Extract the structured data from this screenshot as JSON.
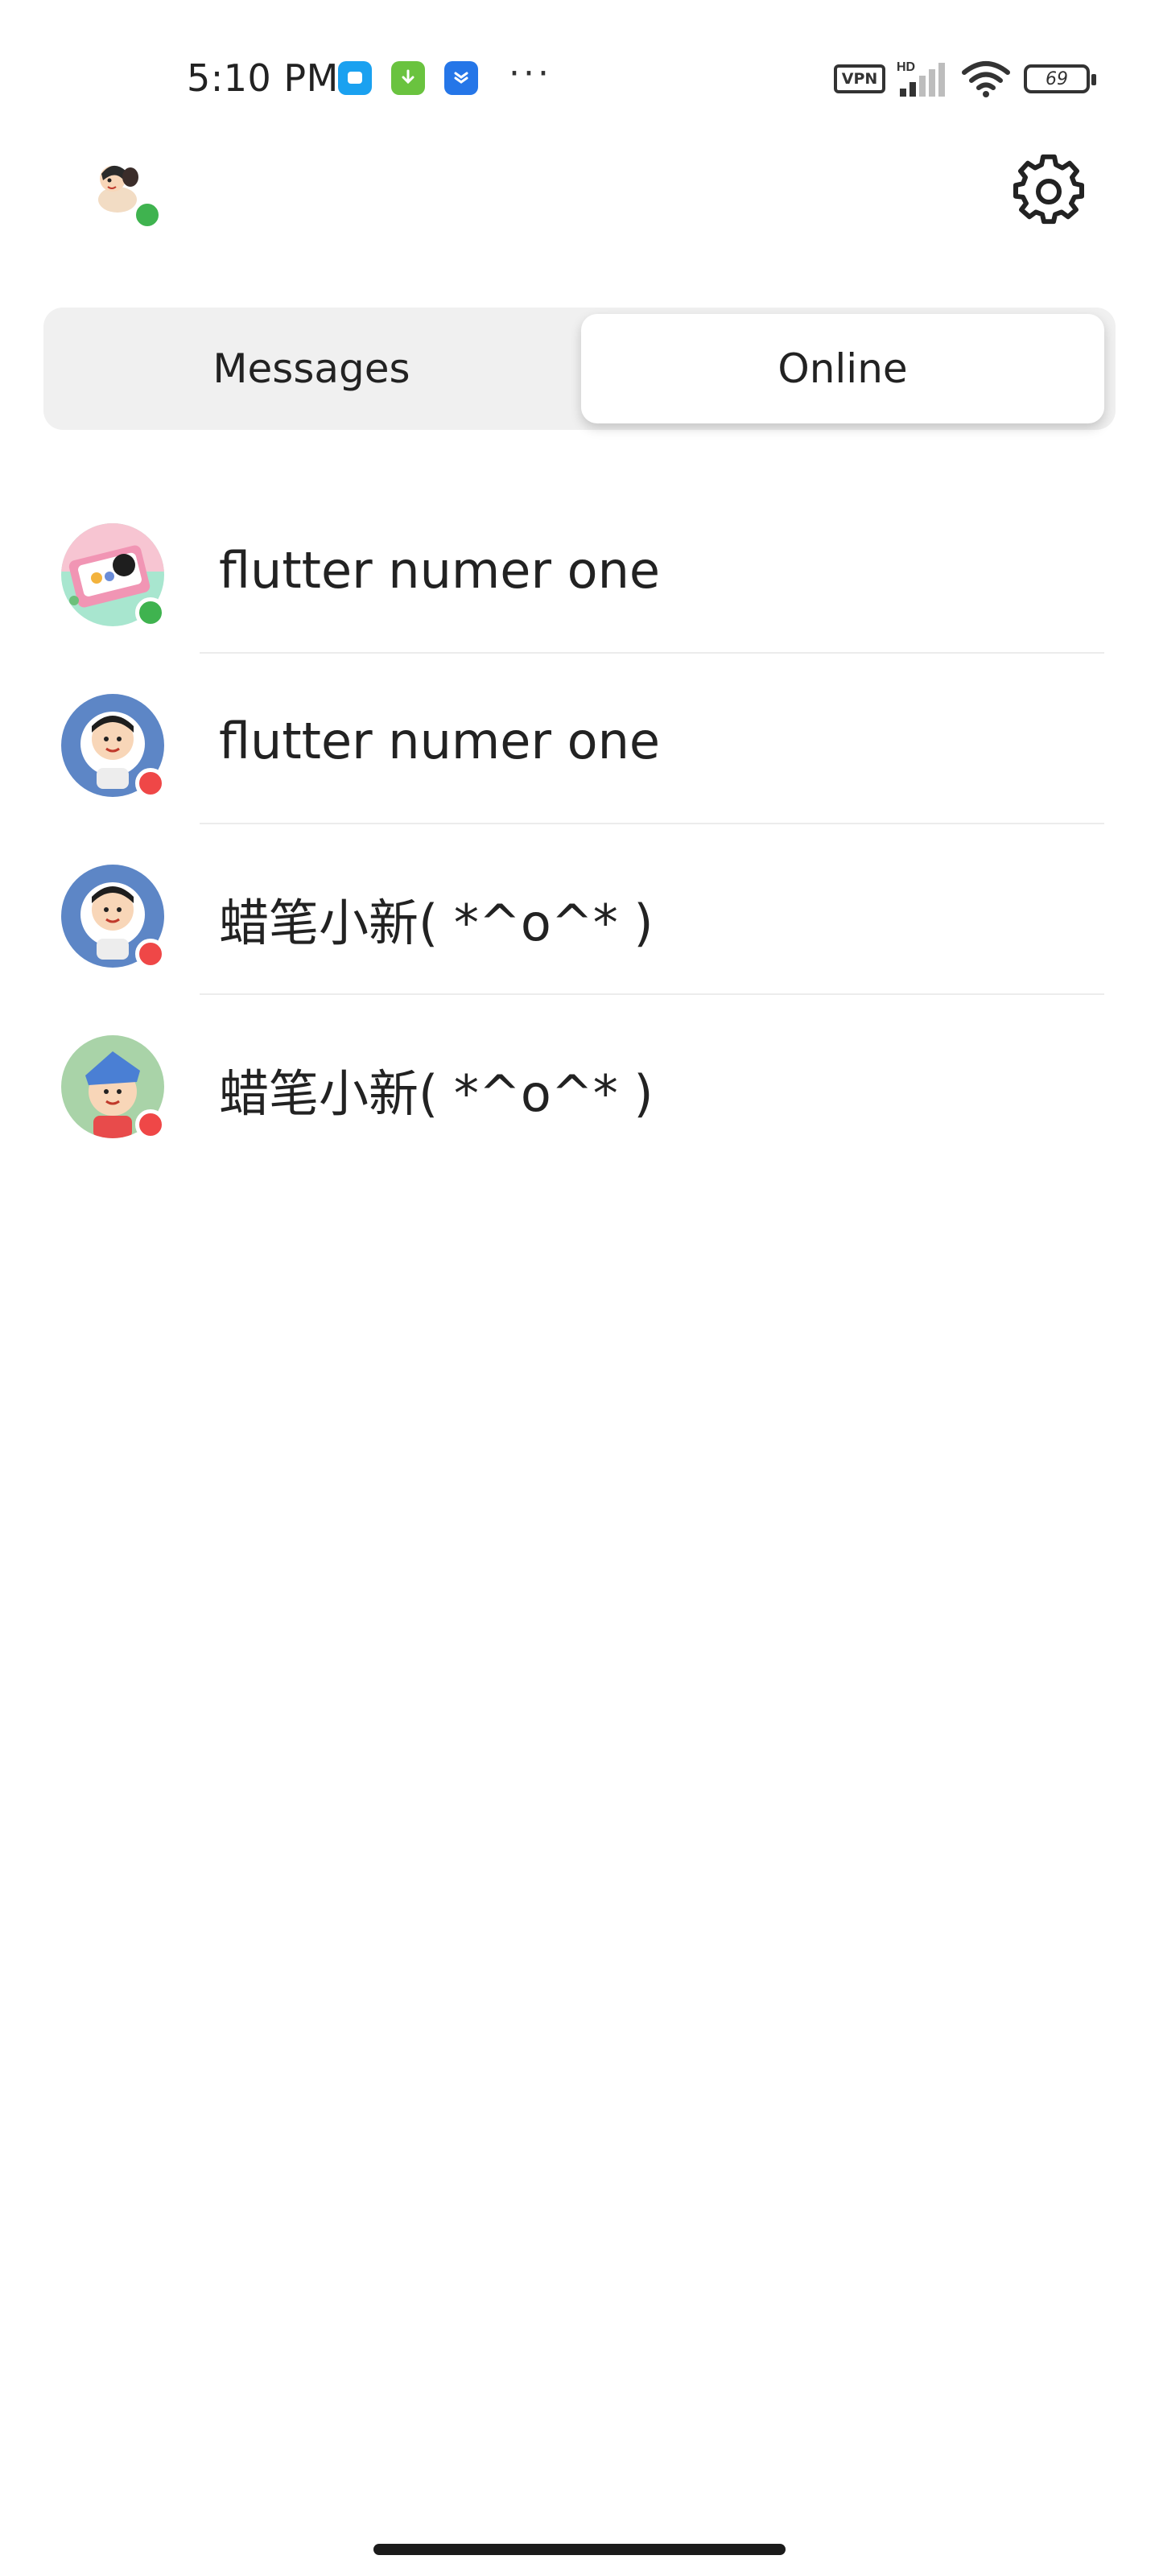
{
  "status_bar": {
    "time": "5:10 PM",
    "more": "···",
    "vpn_label": "VPN",
    "network_label": "HD",
    "battery_level": "69",
    "notification_icons": [
      "message-app-icon",
      "download-app-icon",
      "store-app-icon"
    ]
  },
  "header": {
    "my_status": "online",
    "settings_icon": "gear-icon"
  },
  "tabs": {
    "messages_label": "Messages",
    "online_label": "Online",
    "selected": "Online"
  },
  "contacts": [
    {
      "name": "flutter numer one",
      "status": "online"
    },
    {
      "name": "flutter numer one",
      "status": "offline"
    },
    {
      "name": "蜡笔小新( *^o^* )",
      "status": "offline"
    },
    {
      "name": "蜡笔小新( *^o^* )",
      "status": "offline"
    }
  ],
  "colors": {
    "online": "#3fb34f",
    "offline": "#ef4747",
    "tab_track": "#f0f0f0",
    "tab_selected": "#ffffff"
  }
}
